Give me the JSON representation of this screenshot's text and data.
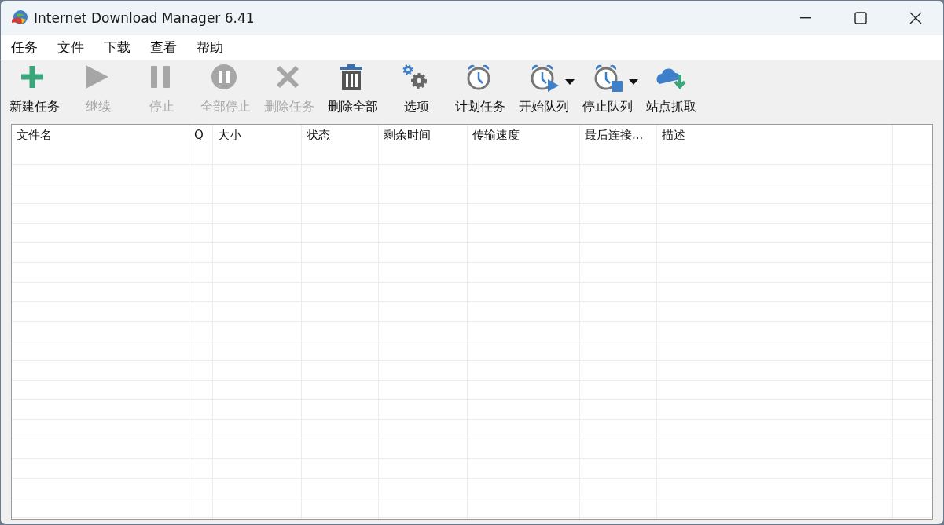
{
  "window": {
    "title": "Internet Download Manager 6.41"
  },
  "menu": [
    "任务",
    "文件",
    "下载",
    "查看",
    "帮助"
  ],
  "toolbar": [
    {
      "kind": "add",
      "label": "新建任务",
      "disabled": false,
      "has_menu": false
    },
    {
      "kind": "resume",
      "label": "继续",
      "disabled": true,
      "has_menu": false
    },
    {
      "kind": "pause",
      "label": "停止",
      "disabled": true,
      "has_menu": false
    },
    {
      "kind": "stop-all",
      "label": "全部停止",
      "disabled": true,
      "has_menu": false
    },
    {
      "kind": "delete",
      "label": "删除任务",
      "disabled": true,
      "has_menu": false
    },
    {
      "kind": "trash",
      "label": "删除全部",
      "disabled": false,
      "has_menu": false
    },
    {
      "kind": "gears",
      "label": "选项",
      "disabled": false,
      "has_menu": false
    },
    {
      "kind": "clock",
      "label": "计划任务",
      "disabled": false,
      "has_menu": false
    },
    {
      "kind": "clock-play",
      "label": "开始队列",
      "disabled": false,
      "has_menu": true
    },
    {
      "kind": "clock-stop",
      "label": "停止队列",
      "disabled": false,
      "has_menu": true
    },
    {
      "kind": "cloud",
      "label": "站点抓取",
      "disabled": false,
      "has_menu": false
    }
  ],
  "table": {
    "columns": [
      "文件名",
      "Q",
      "大小",
      "状态",
      "剩余时间",
      "传输速度",
      "最后连接...",
      "描述"
    ]
  }
}
